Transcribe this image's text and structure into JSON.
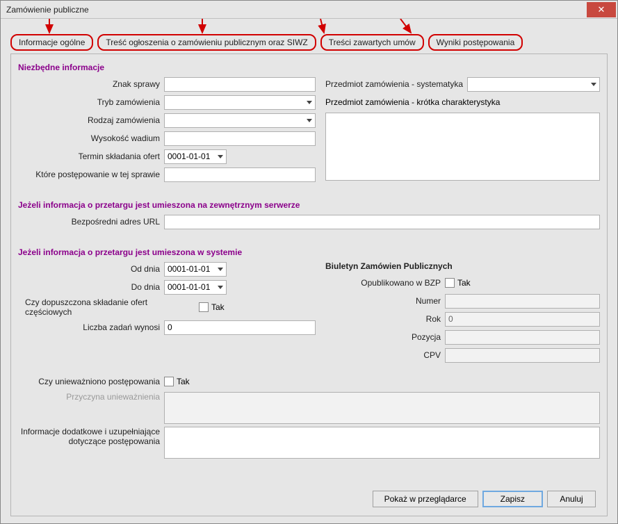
{
  "window": {
    "title": "Zamówienie publiczne",
    "close_x": "✕"
  },
  "tabs": {
    "t0": "Informacje ogólne",
    "t1": "Treść ogłoszenia o zamówieniu publicznym oraz SIWZ",
    "t2": "Treści zawartych umów",
    "t3": "Wyniki postępowania"
  },
  "s1": {
    "title": "Niezbędne informacje",
    "znak_sprawy_lbl": "Znak sprawy",
    "znak_sprawy_val": "",
    "tryb_lbl": "Tryb zamówienia",
    "tryb_val": "",
    "rodzaj_lbl": "Rodzaj zamówienia",
    "rodzaj_val": "",
    "wadium_lbl": "Wysokość wadium",
    "wadium_val": "",
    "termin_lbl": "Termin składania ofert",
    "termin_val": "0001-01-01",
    "ktore_lbl": "Które postępowanie w tej sprawie",
    "ktore_val": "",
    "przedmiot_sys_lbl": "Przedmiot zamówienia - systematyka",
    "przedmiot_sys_val": "",
    "przedmiot_char_lbl": "Przedmiot zamówienia - krótka charakterystyka",
    "przedmiot_char_val": ""
  },
  "s2": {
    "title": "Jeżeli informacja o przetargu jest umieszona na zewnętrznym serwerze",
    "url_lbl": "Bezpośredni adres URL",
    "url_val": ""
  },
  "s3": {
    "title": "Jeżeli informacja o przetargu jest umieszona w systemie",
    "od_lbl": "Od dnia",
    "od_val": "0001-01-01",
    "do_lbl": "Do dnia",
    "do_val": "0001-01-01",
    "czesc_lbl": "Czy dopuszczona składanie ofert częściowych",
    "tak": "Tak",
    "liczba_lbl": "Liczba zadań wynosi",
    "liczba_val": "0",
    "biuletyn_title": "Biuletyn Zamówien Publicznych",
    "opub_lbl": "Opublikowano w BZP",
    "numer_lbl": "Numer",
    "numer_val": "",
    "rok_lbl": "Rok",
    "rok_val": "0",
    "pozycja_lbl": "Pozycja",
    "pozycja_val": "",
    "cpv_lbl": "CPV",
    "cpv_val": "",
    "uniew_lbl": "Czy unieważniono postępowania",
    "przyczyna_lbl": "Przyczyna unieważnienia",
    "przyczyna_val": "",
    "info_dod_lbl": "Informacje dodatkowe i uzupełniające dotyczące postępowania",
    "info_dod_val": ""
  },
  "footer": {
    "preview": "Pokaż w przeglądarce",
    "save": "Zapisz",
    "cancel": "Anuluj"
  }
}
